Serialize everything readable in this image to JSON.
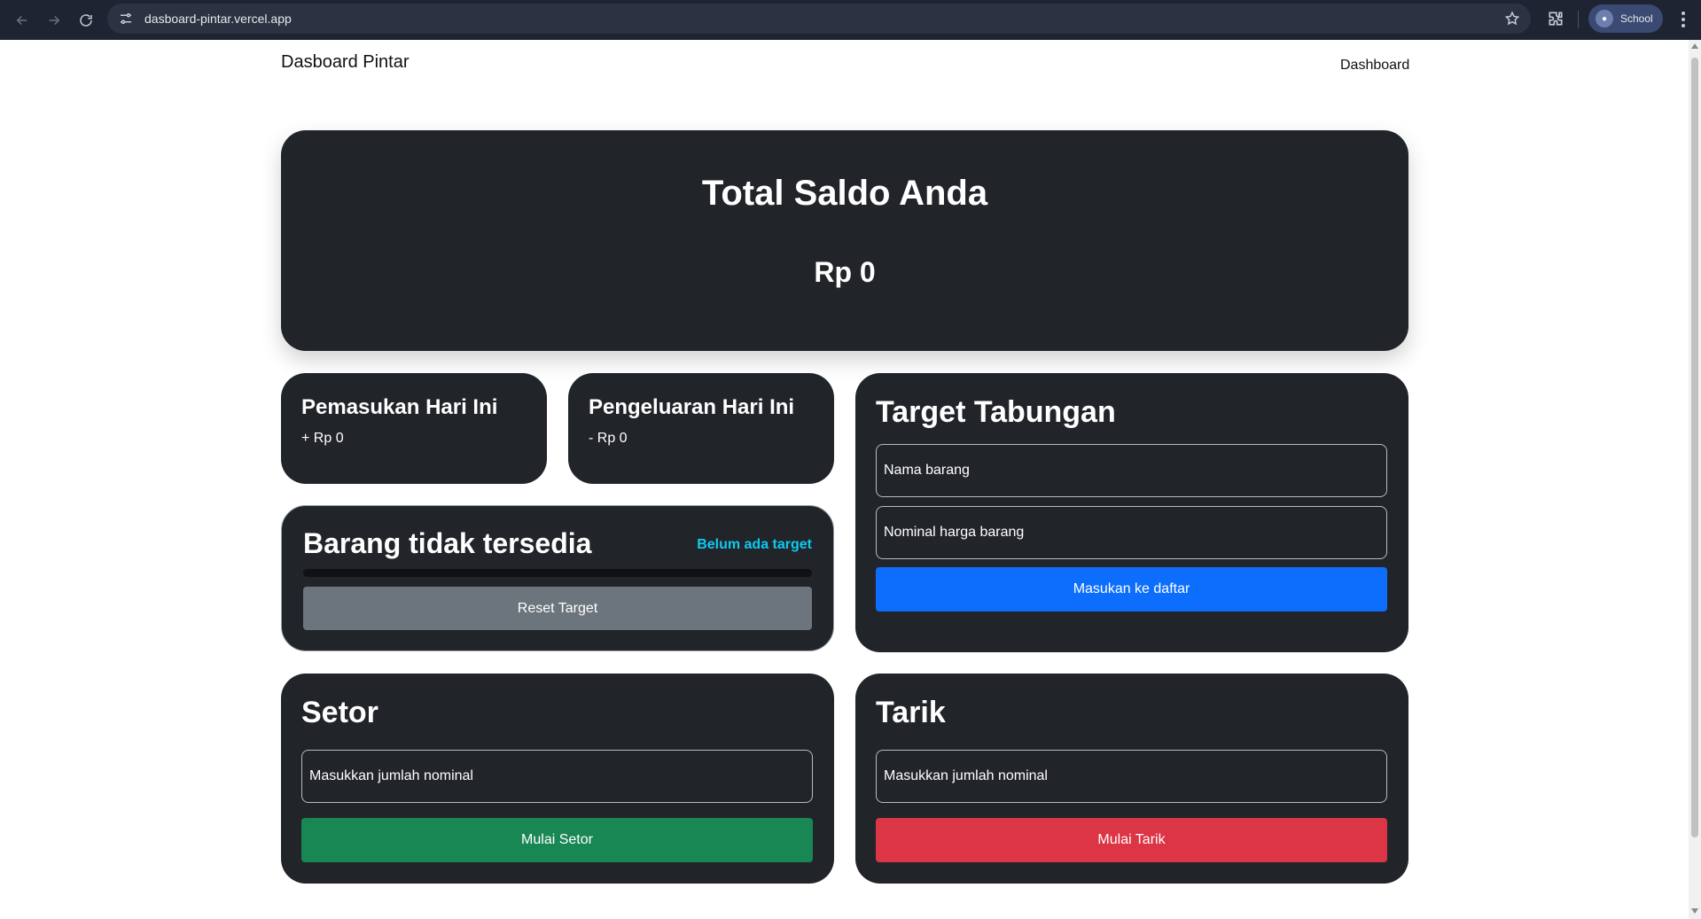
{
  "browser": {
    "url": "dasboard-pintar.vercel.app",
    "profile_label": "School"
  },
  "navbar": {
    "brand": "Dasboard Pintar",
    "link": "Dashboard"
  },
  "balance": {
    "title": "Total Saldo Anda",
    "amount": "Rp 0"
  },
  "income": {
    "title": "Pemasukan Hari Ini",
    "amount": "+ Rp 0"
  },
  "expense": {
    "title": "Pengeluaran Hari Ini",
    "amount": "- Rp 0"
  },
  "target_status": {
    "item_name": "Barang tidak tersedia",
    "badge": "Belum ada target",
    "progress_percent": 0,
    "reset_label": "Reset Target"
  },
  "target_form": {
    "title": "Target Tabungan",
    "name_placeholder": "Nama barang",
    "price_placeholder": "Nominal harga barang",
    "submit_label": "Masukan ke daftar"
  },
  "deposit": {
    "title": "Setor",
    "placeholder": "Masukkan jumlah nominal",
    "button_label": "Mulai Setor"
  },
  "withdraw": {
    "title": "Tarik",
    "placeholder": "Masukkan jumlah nominal",
    "button_label": "Mulai Tarik"
  },
  "colors": {
    "card_bg": "#212529",
    "primary": "#0d6efd",
    "success": "#198754",
    "danger": "#dc3545",
    "secondary": "#6c757d",
    "info": "#0dcaf0"
  }
}
